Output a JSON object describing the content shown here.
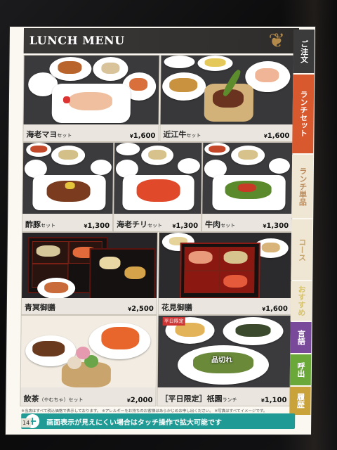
{
  "header": {
    "title": "LUNCH MENU"
  },
  "items": [
    {
      "name": "海老マヨ",
      "suffix": "セット",
      "price": "1,600",
      "yen": "¥"
    },
    {
      "name": "近江牛",
      "suffix": "セット",
      "price": "1,600",
      "yen": "¥"
    },
    {
      "name": "酢豚",
      "suffix": "セット",
      "price": "1,300",
      "yen": "¥"
    },
    {
      "name": "海老チリ",
      "suffix": "セット",
      "price": "1,300",
      "yen": "¥"
    },
    {
      "name": "牛肉",
      "suffix": "セット",
      "price": "1,300",
      "yen": "¥"
    },
    {
      "name": "青冥御膳",
      "suffix": "",
      "price": "2,500",
      "yen": "¥"
    },
    {
      "name": "花見御膳",
      "suffix": "",
      "price": "1,600",
      "yen": "¥"
    },
    {
      "name": "飲茶",
      "suffix": "（やむちゃ）セット",
      "price": "2,000",
      "yen": "¥"
    },
    {
      "name": "［平日限定］祇園",
      "suffix": "ランチ",
      "price": "1,100",
      "yen": "¥"
    }
  ],
  "weekday_tag": "平日限定",
  "sold_out": "品切れ",
  "tabs": [
    {
      "label": "ご注文",
      "color": "#3b3b3b"
    },
    {
      "label": "ランチセット",
      "color": "#d9592f"
    },
    {
      "label": "ランチ単品",
      "color": "#b98a5b"
    },
    {
      "label": "コース",
      "color": "#c7a46c"
    },
    {
      "label": "おすすめ",
      "color": "#d6c26b"
    },
    {
      "label": "言語",
      "color": "#7a4a9a"
    },
    {
      "label": "呼出",
      "color": "#6aa83a"
    },
    {
      "label": "履歴",
      "color": "#c9a23a"
    }
  ],
  "note": "※当店はすべて税込価格で表示しております。 ※アレルギーをお持ちのお客様はあらかじめお申し出ください。 ※写真はすべてイメージです。",
  "footer": {
    "text": "画面表示が見えにくい場合はタッチ操作で拡大可能です",
    "zoom_icon": "+"
  },
  "page_number": "14"
}
